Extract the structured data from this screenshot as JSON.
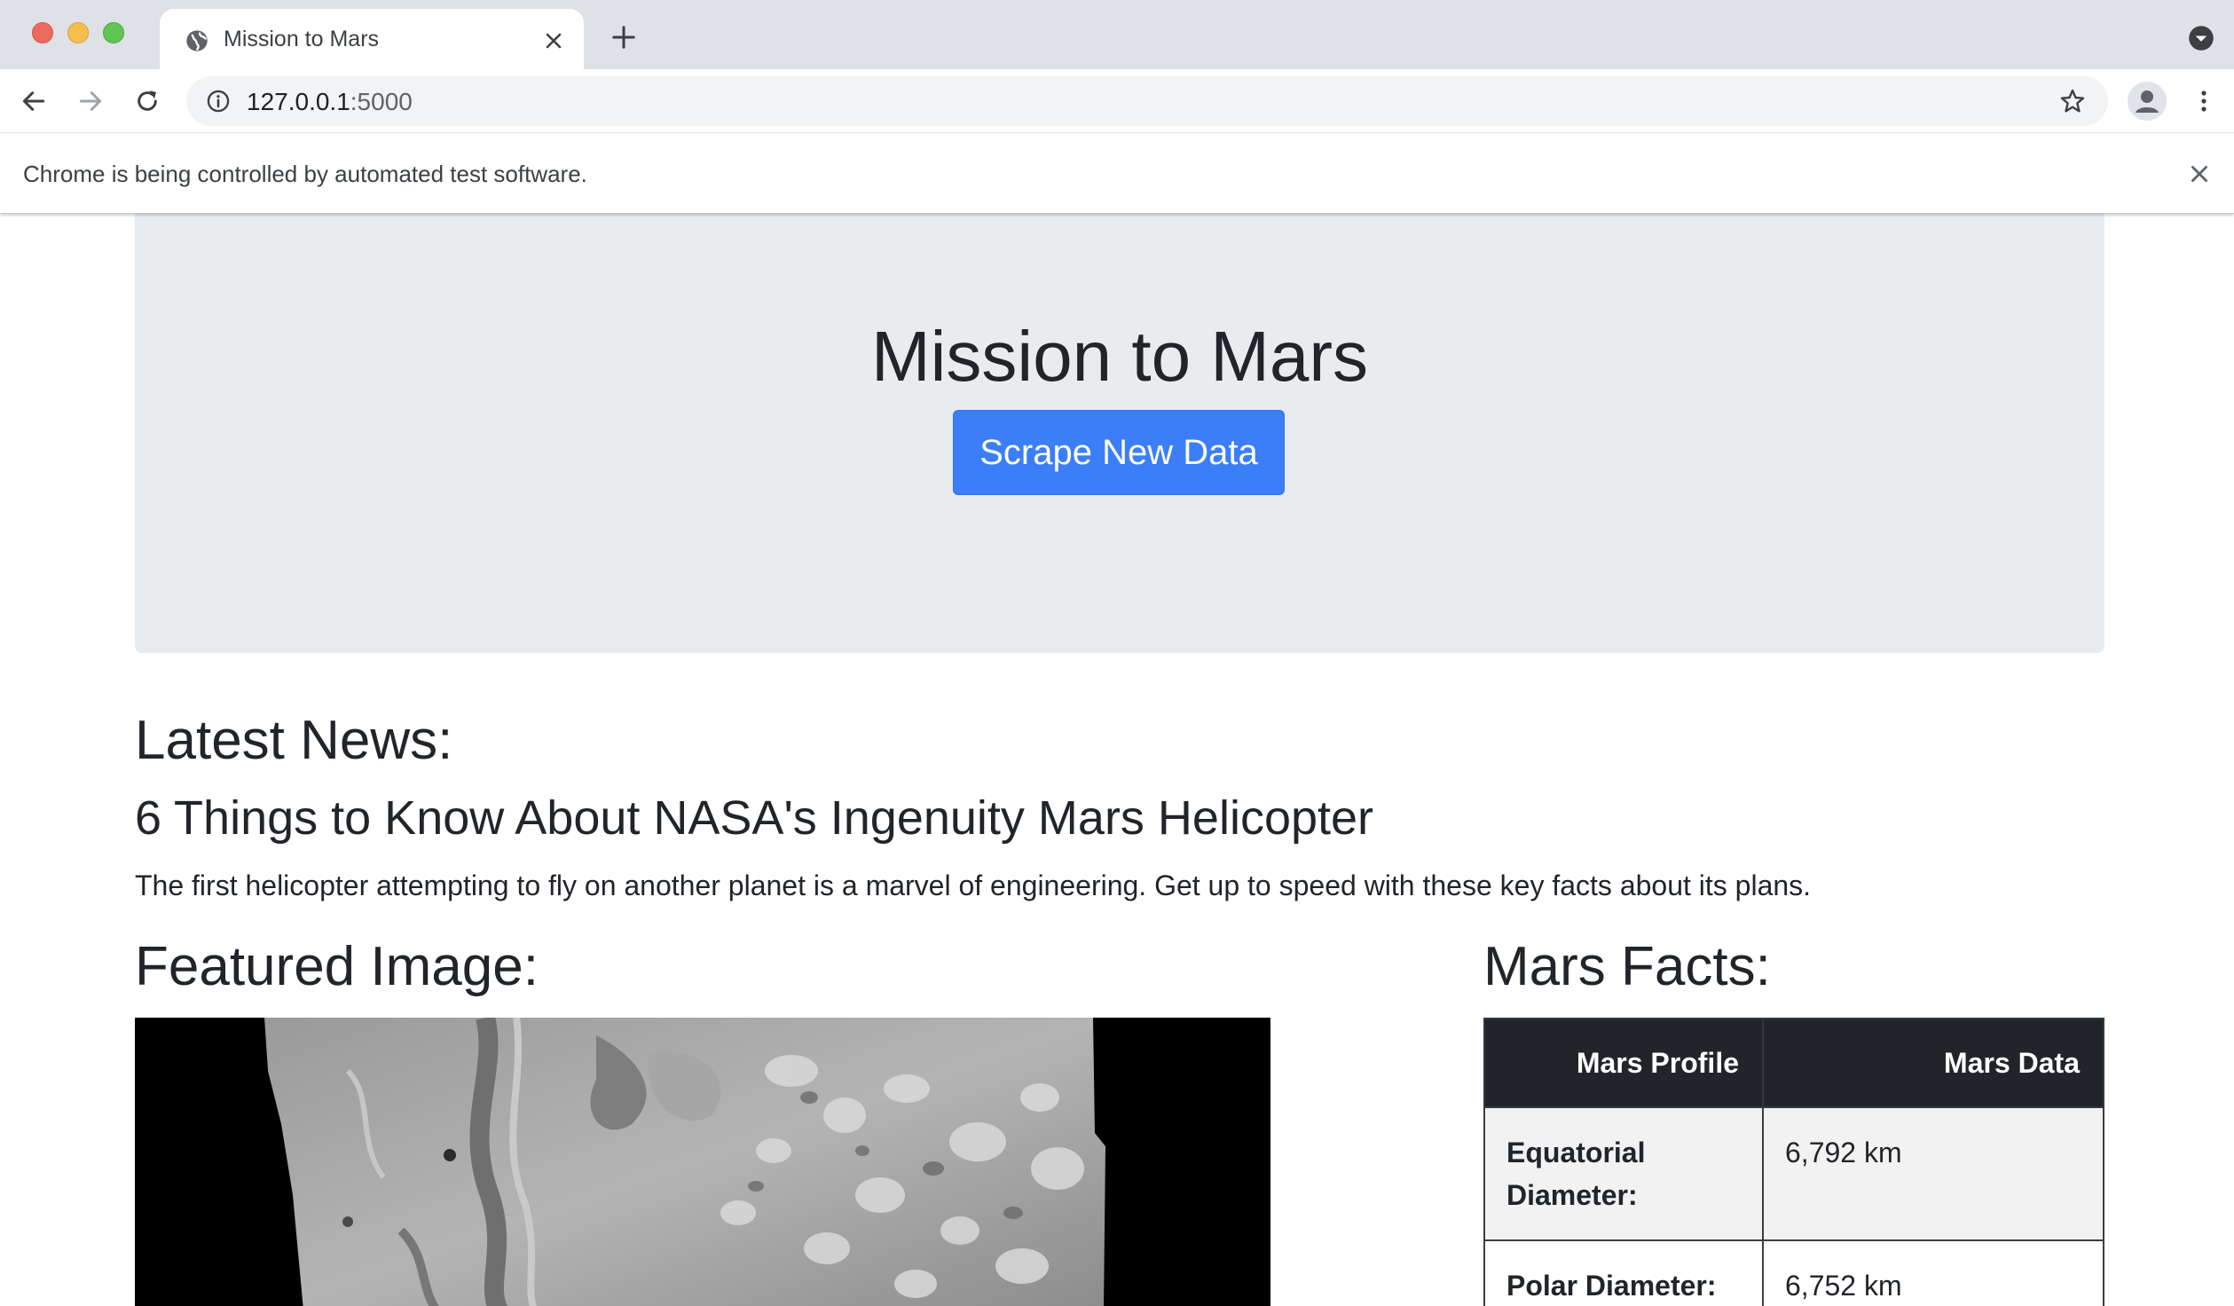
{
  "browser": {
    "tab_title": "Mission to Mars",
    "url_host": "127.0.0.1",
    "url_port": ":5000",
    "infobar_text": "Chrome is being controlled by automated test software."
  },
  "page": {
    "title": "Mission to Mars",
    "scrape_button": "Scrape New Data",
    "news_heading": "Latest News:",
    "news_title": "6 Things to Know About NASA's Ingenuity Mars Helicopter",
    "news_paragraph": "The first helicopter attempting to fly on another planet is a marvel of engineering. Get up to speed with these key facts about its plans.",
    "featured_heading": "Featured Image:",
    "facts_heading": "Mars Facts:",
    "facts_table": {
      "headers": [
        "Mars Profile",
        "Mars Data"
      ],
      "rows": [
        {
          "label": "Equatorial Diameter:",
          "value": "6,792 km"
        },
        {
          "label": "Polar Diameter:",
          "value": "6,752 km"
        }
      ]
    }
  },
  "colors": {
    "jumbotron": "#e9ecef",
    "primary_button": "#3b7ef7",
    "table_header": "#212529"
  }
}
